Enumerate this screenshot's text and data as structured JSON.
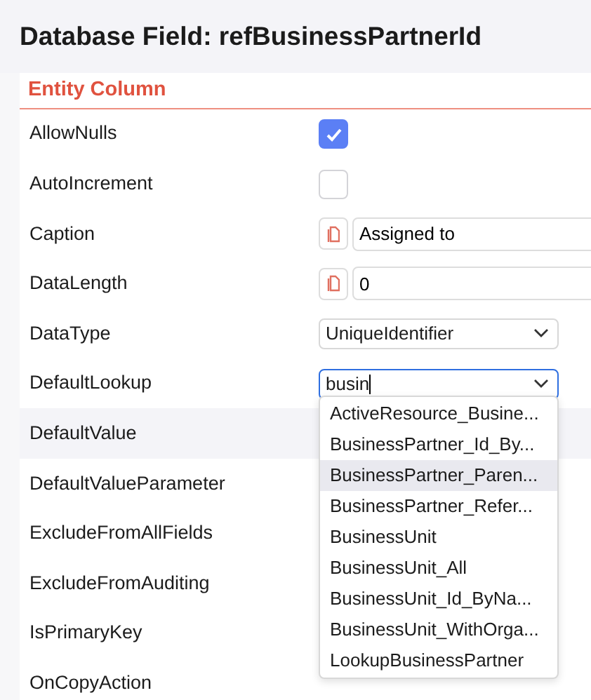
{
  "title": "Database Field: refBusinessPartnerId",
  "section": "Entity Column",
  "rows": [
    {
      "label": "AllowNulls",
      "kind": "checkbox",
      "checked": true
    },
    {
      "label": "AutoIncrement",
      "kind": "checkbox",
      "checked": false
    },
    {
      "label": "Caption",
      "kind": "text",
      "value": "Assigned to"
    },
    {
      "label": "DataLength",
      "kind": "text",
      "value": "0"
    },
    {
      "label": "DataType",
      "kind": "select",
      "value": "UniqueIdentifier"
    },
    {
      "label": "DefaultLookup",
      "kind": "combo",
      "value": "busin"
    },
    {
      "label": "DefaultValue",
      "kind": "none",
      "hovered": true
    },
    {
      "label": "DefaultValueParameter",
      "kind": "none"
    },
    {
      "label": "ExcludeFromAllFields",
      "kind": "none"
    },
    {
      "label": "ExcludeFromAuditing",
      "kind": "none"
    },
    {
      "label": "IsPrimaryKey",
      "kind": "none"
    },
    {
      "label": "OnCopyAction",
      "kind": "none"
    }
  ],
  "dropdown": [
    {
      "label": "ActiveResource_Busine...",
      "selected": false
    },
    {
      "label": "BusinessPartner_Id_By...",
      "selected": false
    },
    {
      "label": "BusinessPartner_Paren...",
      "selected": true
    },
    {
      "label": "BusinessPartner_Refer...",
      "selected": false
    },
    {
      "label": "BusinessUnit",
      "selected": false
    },
    {
      "label": "BusinessUnit_All",
      "selected": false
    },
    {
      "label": "BusinessUnit_Id_ByNa...",
      "selected": false
    },
    {
      "label": "BusinessUnit_WithOrga...",
      "selected": false
    },
    {
      "label": "LookupBusinessPartner",
      "selected": false
    }
  ]
}
